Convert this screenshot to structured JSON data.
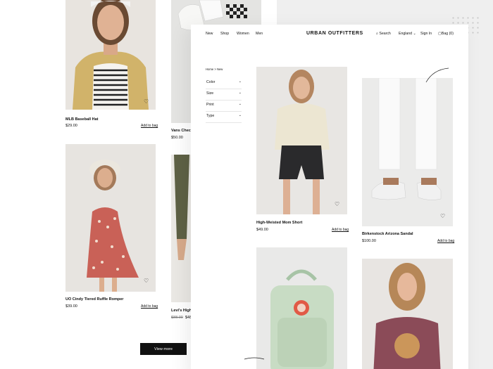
{
  "back_page": {
    "products": [
      {
        "title": "MLB Baseball Hat",
        "price": "$29.00",
        "add_to_bag": "Add to bag"
      },
      {
        "title": "Vans Checke",
        "price": "$50.00"
      },
      {
        "title": "UO Cindy Tiered Ruffle Romper",
        "price": "$39.00",
        "add_to_bag": "Add to bag"
      },
      {
        "title": "Levi's High W",
        "price_old": "$88.00",
        "price": "$48.00"
      }
    ],
    "view_more": "View more"
  },
  "front_page": {
    "nav": {
      "new": "New",
      "shop": "Shop",
      "women": "Women",
      "men": "Men",
      "logo": "URBAN OUTFITTERS",
      "search": "Search",
      "region": "England",
      "signin": "Sign In",
      "bag": "Bag (0)"
    },
    "breadcrumb": "Home > New",
    "filters": [
      "Color",
      "Size",
      "Print",
      "Type"
    ],
    "products": [
      {
        "title": "High-Weisted Mom Short",
        "price": "$49.00",
        "add_to_bag": "Add to bag"
      },
      {
        "title": "Birkenstock Arizona Sandal",
        "price": "$100.00",
        "add_to_bag": "Add to bag"
      }
    ]
  },
  "icons": {
    "heart": "heart-icon",
    "search": "search-icon",
    "bag": "bag-icon",
    "chevron": "chevron-down-icon"
  },
  "colors": {
    "accent": "#111111",
    "background": "#efefef",
    "card": "#ffffff"
  }
}
